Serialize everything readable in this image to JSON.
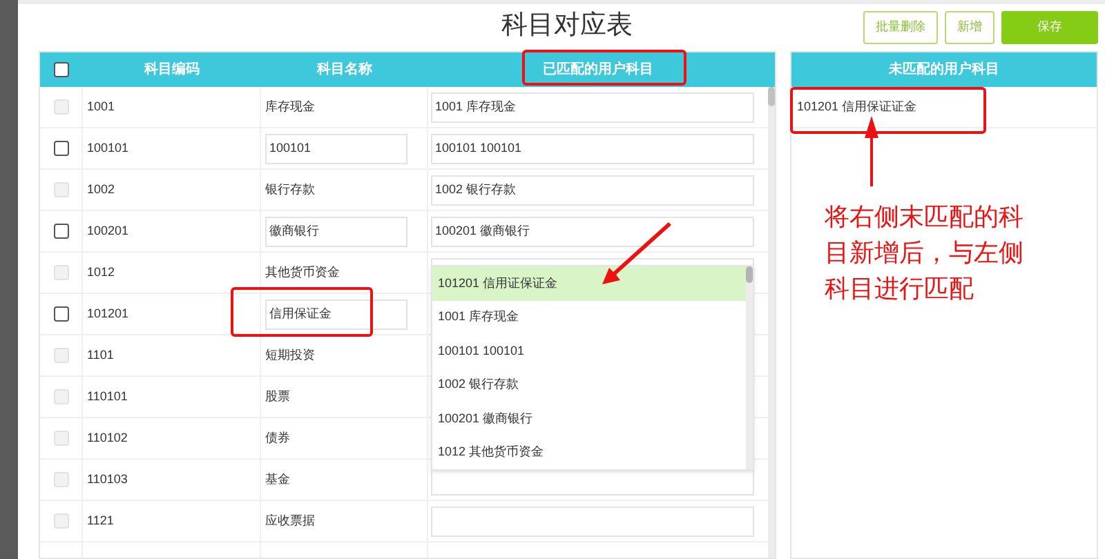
{
  "title": "科目对应表",
  "buttons": [
    {
      "label": "批量删除",
      "kind": "outline"
    },
    {
      "label": "新增",
      "kind": "outline"
    },
    {
      "label": "保存",
      "kind": "primary"
    }
  ],
  "table": {
    "select_all": {
      "checked": false
    },
    "columns": [
      "科目编码",
      "科目名称",
      "已匹配的用户科目"
    ],
    "rows": [
      {
        "code": "1001",
        "name": "库存现金",
        "kind": "text",
        "matched": "1001 库存现金",
        "checkbox": {
          "checked": false,
          "disabled": true
        }
      },
      {
        "code": "100101",
        "name": "100101",
        "kind": "input",
        "matched": "100101 100101",
        "checkbox": {
          "checked": false,
          "disabled": false
        }
      },
      {
        "code": "1002",
        "name": "银行存款",
        "kind": "text",
        "matched": "1002 银行存款",
        "checkbox": {
          "checked": false,
          "disabled": true
        }
      },
      {
        "code": "100201",
        "name": "徽商银行",
        "kind": "input",
        "matched": "100201 徽商银行",
        "checkbox": {
          "checked": false,
          "disabled": false
        }
      },
      {
        "code": "1012",
        "name": "其他货币资金",
        "kind": "text",
        "matched": "",
        "checkbox": {
          "checked": false,
          "disabled": true
        }
      },
      {
        "code": "101201",
        "name": "信用保证金",
        "kind": "input",
        "matched_field": false,
        "checkbox": {
          "checked": false,
          "disabled": false
        }
      },
      {
        "code": "1101",
        "name": "短期投资",
        "kind": "text",
        "matched_field": false,
        "checkbox": {
          "checked": false,
          "disabled": true
        }
      },
      {
        "code": "110101",
        "name": "股票",
        "kind": "text",
        "matched_field": false,
        "checkbox": {
          "checked": false,
          "disabled": true
        }
      },
      {
        "code": "110102",
        "name": "债券",
        "kind": "text",
        "matched_field": false,
        "checkbox": {
          "checked": false,
          "disabled": true
        }
      },
      {
        "code": "110103",
        "name": "基金",
        "kind": "text",
        "matched": "",
        "checkbox": {
          "checked": false,
          "disabled": true
        }
      },
      {
        "code": "1121",
        "name": "应收票据",
        "kind": "text",
        "matched": "",
        "checkbox": {
          "checked": false,
          "disabled": true
        }
      }
    ],
    "dropdown": {
      "options": [
        {
          "label": "101201 信用证保证金",
          "selected": true
        },
        {
          "label": "1001 库存现金",
          "selected": false
        },
        {
          "label": "100101 100101",
          "selected": false
        },
        {
          "label": "1002 银行存款",
          "selected": false
        },
        {
          "label": "100201 徽商银行",
          "selected": false
        },
        {
          "label": "1012 其他货币资金",
          "selected": false
        }
      ]
    }
  },
  "unmatched": {
    "header": "未匹配的用户科目",
    "items": [
      "101201 信用保证证金"
    ]
  },
  "annotation": {
    "text": "将右侧末匹配的科目新增后，与左侧科目进行匹配"
  }
}
